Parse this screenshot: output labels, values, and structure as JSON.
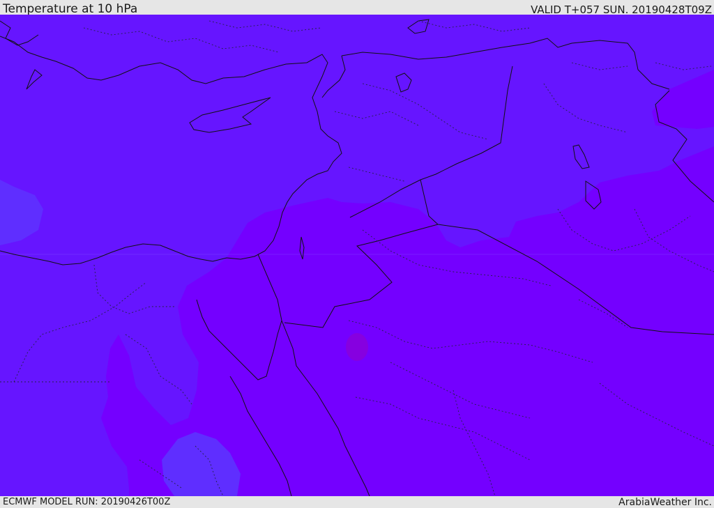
{
  "header": {
    "title": "Temperature at 10 hPa",
    "valid": "VALID T+057 SUN. 20190428T09Z"
  },
  "footer": {
    "model_run": "ECMWF MODEL RUN: 20190426T00Z",
    "brand": "ArabiaWeather Inc."
  },
  "colors": {
    "background_bar": "#e6e6e6",
    "temp_cold": "#6615ff",
    "temp_mid": "#7400ff",
    "temp_coldest": "#5f2eff",
    "temp_warm_spot": "#8c00d6",
    "boundary": "#111111"
  },
  "map": {
    "region": "Eastern Mediterranean, Levant, Arabia, NE Africa",
    "layers": [
      "temperature-field",
      "coastlines",
      "national-borders",
      "admin-borders"
    ]
  }
}
